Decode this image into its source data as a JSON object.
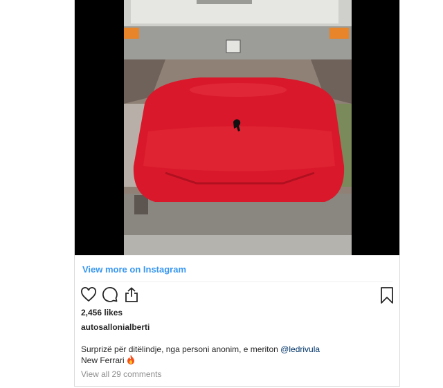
{
  "media": {
    "alt_icon": "ferrari-logo-icon"
  },
  "links": {
    "view_more": "View more on Instagram"
  },
  "actions": {
    "like_icon": "heart-icon",
    "comment_icon": "comment-icon",
    "share_icon": "share-icon",
    "save_icon": "bookmark-icon"
  },
  "post": {
    "likes": "2,456 likes",
    "username": "autosallonialberti",
    "caption_text": "Surprizë për ditëlindje, nga personi anonim, e meriton ",
    "caption_mention": "@ledrivula",
    "caption_line2": "New Ferrari",
    "caption_emoji": "fire-icon",
    "comments": "View all 29 comments"
  },
  "colors": {
    "link_blue": "#3897f0",
    "text": "#262626",
    "muted": "#8e8e8e",
    "car_red": "#d9192b"
  }
}
